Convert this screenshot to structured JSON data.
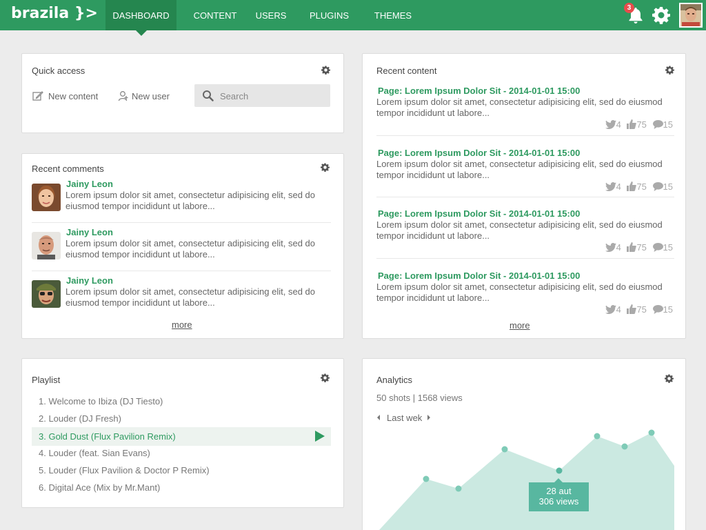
{
  "brand": {
    "logo": "brazila }>"
  },
  "nav": {
    "items": [
      {
        "label": "DASHBOARD",
        "active": true
      },
      {
        "label": "CONTENT"
      },
      {
        "label": "USERS"
      },
      {
        "label": "PLUGINS"
      },
      {
        "label": "THEMES"
      }
    ]
  },
  "header": {
    "notifications_count": "3",
    "icons": [
      "bell-icon",
      "gear-icon",
      "user-avatar"
    ]
  },
  "quick_access": {
    "title": "Quick access",
    "new_content_label": "New content",
    "new_user_label": "New user",
    "search_placeholder": "Search"
  },
  "recent_comments": {
    "title": "Recent comments",
    "items": [
      {
        "author": "Jainy Leon",
        "text": "Lorem ipsum dolor sit amet, consectetur adipisicing elit, sed do eiusmod tempor incididunt ut labore..."
      },
      {
        "author": "Jainy Leon",
        "text": "Lorem ipsum dolor sit amet, consectetur adipisicing elit, sed do eiusmod tempor incididunt ut labore..."
      },
      {
        "author": "Jainy Leon",
        "text": "Lorem ipsum dolor sit amet, consectetur adipisicing elit, sed do eiusmod tempor incididunt ut labore..."
      }
    ],
    "more_label": "more"
  },
  "recent_content": {
    "title": "Recent content",
    "items": [
      {
        "title": "Page: Lorem Ipsum Dolor Sit - 2014-01-01 15:00",
        "text": "Lorem ipsum dolor sit amet, consectetur adipisicing elit, sed do eiusmod tempor incididunt ut labore...",
        "tweets": "4",
        "likes": "75",
        "comments": "15"
      },
      {
        "title": "Page: Lorem Ipsum Dolor Sit - 2014-01-01 15:00",
        "text": "Lorem ipsum dolor sit amet, consectetur adipisicing elit, sed do eiusmod tempor incididunt ut labore...",
        "tweets": "4",
        "likes": "75",
        "comments": "15"
      },
      {
        "title": "Page: Lorem Ipsum Dolor Sit - 2014-01-01 15:00",
        "text": "Lorem ipsum dolor sit amet, consectetur adipisicing elit, sed do eiusmod tempor incididunt ut labore...",
        "tweets": "4",
        "likes": "75",
        "comments": "15"
      },
      {
        "title": "Page: Lorem Ipsum Dolor Sit - 2014-01-01 15:00",
        "text": "Lorem ipsum dolor sit amet, consectetur adipisicing elit, sed do eiusmod tempor incididunt ut labore...",
        "tweets": "4",
        "likes": "75",
        "comments": "15"
      }
    ],
    "more_label": "more"
  },
  "playlist": {
    "title": "Playlist",
    "active_index": 2,
    "items": [
      "1.  Welcome to Ibiza (DJ Tiesto)",
      "2.  Louder (DJ Fresh)",
      "3.  Gold Dust (Flux Pavilion Remix)",
      "4.  Louder (feat. Sian Evans)",
      "5.  Louder (Flux Pavilion & Doctor P Remix)",
      "6.  Digital Ace (Mix by Mr.Mant)"
    ]
  },
  "analytics": {
    "title": "Analytics",
    "summary": "50 shots  |  1568 views",
    "period_label": "Last wek",
    "tooltip_line1": "28 aut",
    "tooltip_line2": "306 views"
  },
  "colors": {
    "brand_green": "#2e9a60",
    "nav_active": "#25864f",
    "chart_fill": "#cbe9e1",
    "chart_point": "#7fcbb7",
    "tooltip_bg": "#58b7a0",
    "badge_red": "#e84c4c"
  }
}
